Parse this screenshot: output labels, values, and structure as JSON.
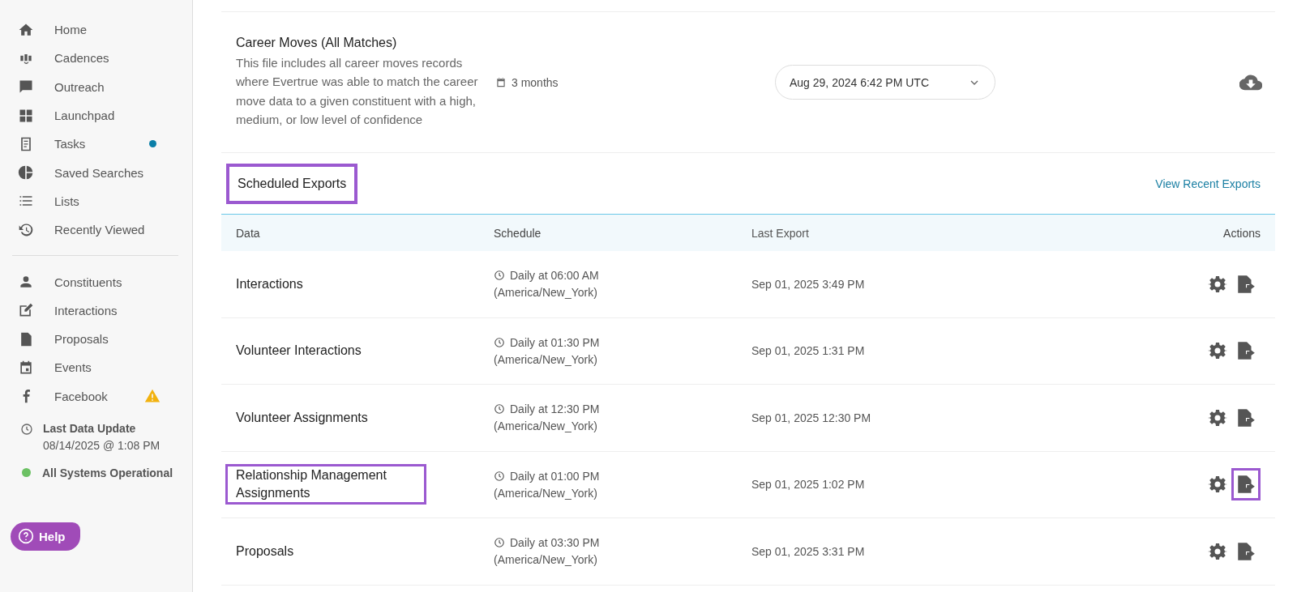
{
  "sidebar": {
    "nav_primary": [
      {
        "label": "Home",
        "notification": false,
        "warning": false
      },
      {
        "label": "Cadences",
        "notification": false,
        "warning": false
      },
      {
        "label": "Outreach",
        "notification": false,
        "warning": false
      },
      {
        "label": "Launchpad",
        "notification": false,
        "warning": false
      },
      {
        "label": "Tasks",
        "notification": true,
        "warning": false
      },
      {
        "label": "Saved Searches",
        "notification": false,
        "warning": false
      },
      {
        "label": "Lists",
        "notification": false,
        "warning": false
      },
      {
        "label": "Recently Viewed",
        "notification": false,
        "warning": false
      }
    ],
    "nav_secondary": [
      {
        "label": "Constituents",
        "notification": false,
        "warning": false
      },
      {
        "label": "Interactions",
        "notification": false,
        "warning": false
      },
      {
        "label": "Proposals",
        "notification": false,
        "warning": false
      },
      {
        "label": "Events",
        "notification": false,
        "warning": false
      },
      {
        "label": "Facebook",
        "notification": false,
        "warning": true
      }
    ],
    "last_update": {
      "label": "Last Data Update",
      "value": "08/14/2025 @ 1:08 PM"
    },
    "system_status": {
      "label": "All Systems Operational",
      "color": "#6cc164"
    },
    "help_button": "Help"
  },
  "file_row": {
    "title": "Career Moves (All Matches)",
    "description": "This file includes all career moves records where Evertrue was able to match the career move data to a given constituent with a high, medium, or low level of confidence",
    "period": "3 months",
    "version_select": "Aug 29, 2024 6:42 PM UTC"
  },
  "scheduled_exports": {
    "title": "Scheduled Exports",
    "title_highlighted": true,
    "link": "View Recent Exports",
    "columns": [
      "Data",
      "Schedule",
      "Last Export",
      "Actions"
    ],
    "rows": [
      {
        "name": "Interactions",
        "schedule": "Daily at 06:00 AM",
        "timezone": "(America/New_York)",
        "last_export": "Sep 01, 2025 3:49 PM",
        "name_highlighted": false,
        "export_highlighted": false
      },
      {
        "name": "Volunteer Interactions",
        "schedule": "Daily at 01:30 PM",
        "timezone": "(America/New_York)",
        "last_export": "Sep 01, 2025 1:31 PM",
        "name_highlighted": false,
        "export_highlighted": false
      },
      {
        "name": "Volunteer Assignments",
        "schedule": "Daily at 12:30 PM",
        "timezone": "(America/New_York)",
        "last_export": "Sep 01, 2025 12:30 PM",
        "name_highlighted": false,
        "export_highlighted": false
      },
      {
        "name": "Relationship Management Assignments",
        "schedule": "Daily at 01:00 PM",
        "timezone": "(America/New_York)",
        "last_export": "Sep 01, 2025 1:02 PM",
        "name_highlighted": true,
        "export_highlighted": true
      },
      {
        "name": "Proposals",
        "schedule": "Daily at 03:30 PM",
        "timezone": "(America/New_York)",
        "last_export": "Sep 01, 2025 3:31 PM",
        "name_highlighted": false,
        "export_highlighted": false
      }
    ]
  }
}
